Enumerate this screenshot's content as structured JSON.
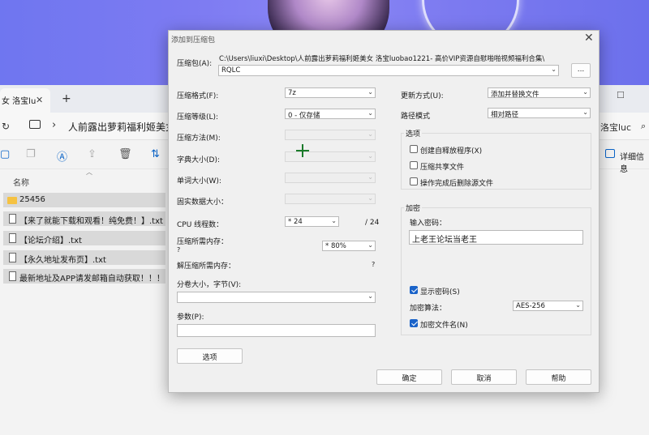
{
  "explorer": {
    "tab_label": "女 洛宝lu",
    "tab_close": "✕",
    "tab_add": "+",
    "address_path": "人前露出萝莉福利姬美女",
    "search_text": "洛宝luc",
    "details_label": "详细信息",
    "column_name": "名称",
    "files": [
      {
        "name": "25456",
        "type": "folder"
      },
      {
        "name": "【来了就能下载和观看！纯免费！】.txt",
        "type": "txt"
      },
      {
        "name": "【论坛介绍】.txt",
        "type": "txt"
      },
      {
        "name": "【永久地址发布页】.txt",
        "type": "txt"
      },
      {
        "name": "最新地址及APP请发邮箱自动获取！！！",
        "type": "txt"
      }
    ]
  },
  "dialog": {
    "title": "添加到压缩包",
    "close": "✕",
    "archive_label": "压缩包(A):",
    "archive_path": "C:\\Users\\liuxi\\Desktop\\人前露出萝莉福利姬美女 洛宝luobao1221- 高价VIP资源自慰啪啪视频福利合集\\",
    "archive_name": "RQLC",
    "browse_button": "...",
    "format_label": "压缩格式(F):",
    "format_value": "7z",
    "level_label": "压缩等级(L):",
    "level_value": "0 - 仅存储",
    "method_label": "压缩方法(M):",
    "dict_label": "字典大小(D):",
    "word_label": "单词大小(W):",
    "solid_label": "固实数据大小：",
    "threads_label": "CPU 线程数：",
    "threads_value": "* 24",
    "threads_total": "/ 24",
    "mem_comp_label": "压缩所需内存：",
    "mem_comp_value": "?",
    "mem_comp_pct": "* 80%",
    "mem_decomp_label": "解压缩所需内存：",
    "mem_decomp_value": "?",
    "volume_label": "分卷大小，字节(V):",
    "params_label": "参数(P):",
    "options_button": "选项",
    "update_label": "更新方式(U):",
    "update_value": "添加并替换文件",
    "path_mode_label": "路径模式",
    "path_mode_value": "相对路径",
    "options_group": "选项",
    "opt_sfx": "创建自释放程序(X)",
    "opt_shared": "压缩共享文件",
    "opt_delete": "操作完成后删除源文件",
    "encrypt_group": "加密",
    "password_label": "输入密码：",
    "password_value": "上老王论坛当老王",
    "show_password": "显示密码(S)",
    "enc_method_label": "加密算法：",
    "enc_method_value": "AES-256",
    "enc_filenames": "加密文件名(N)",
    "ok_button": "确定",
    "cancel_button": "取消",
    "help_button": "帮助"
  }
}
